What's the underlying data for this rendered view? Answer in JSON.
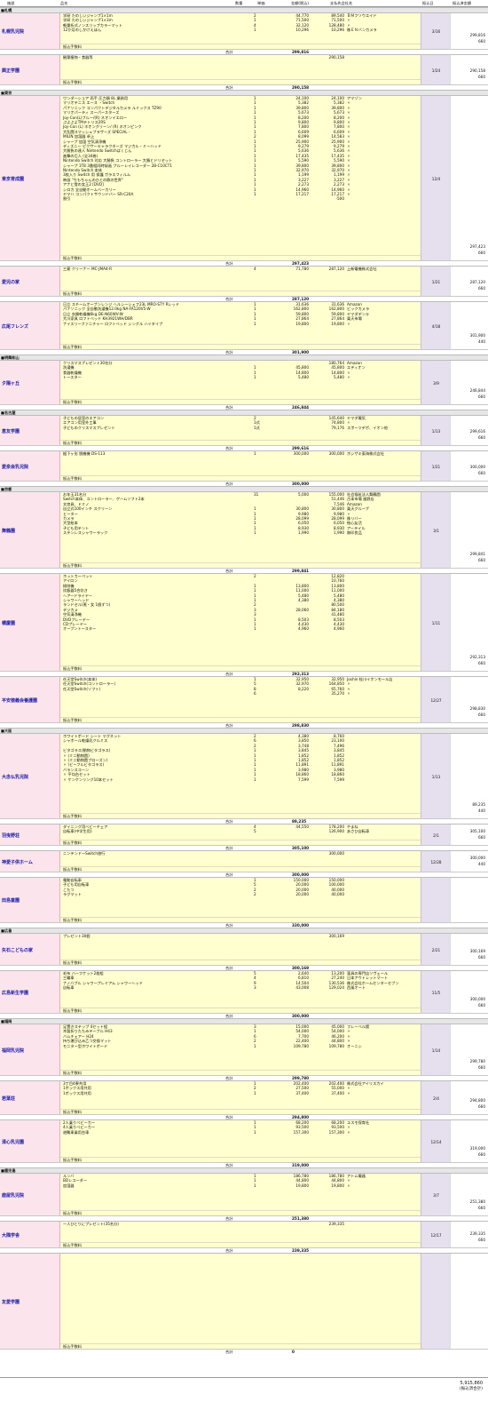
{
  "header": [
    "施設",
    "品名",
    "数量",
    "単価",
    "金額(税込)",
    "支払先会社名",
    "振込日",
    "振込済金額"
  ],
  "fee_label": "振込手数料",
  "total_label": "合計",
  "rows": [
    {
      "r": "■札幌"
    },
    {
      "f": "札幌乳児院",
      "d": "3/16",
      "t": [
        "299,816",
        "660"
      ],
      "s": "299,816",
      "h": 47,
      "i": [
        [
          "学研 たのしいジャンプ1×1m",
          "2",
          "44,770",
          "89,540",
          "ＢＭフソウエイド"
        ],
        [
          "学研 たのしいジャンプ1×3m",
          "1",
          "71,500",
          "71,500",
          "〃"
        ],
        [
          "軽量折式ノンスリップカラーマット",
          "4",
          "32,120",
          "128,480",
          "〃"
        ],
        [
          "12か月のしかけえほん",
          "1",
          "10,296",
          "10,296",
          "株ＥＮバンカメラ"
        ]
      ]
    },
    {
      "f": "興正学園",
      "d": "1/24",
      "t": [
        "290,158",
        "660"
      ],
      "s": "290,158",
      "h": 40,
      "i": [
        [
          "観葉植物・食器等",
          "",
          "",
          "290,158",
          ""
        ]
      ]
    },
    {
      "r": "■東京"
    },
    {
      "f": "東京育成園",
      "d": "12/4",
      "t": [
        "297,423",
        "660"
      ],
      "s": "297,423",
      "h": 192,
      "i": [
        [
          "ワンダーショア 両手 圧力鍋 8L 業務用",
          "1",
          "24,100",
          "24,100",
          "アマゾン"
        ],
        [
          "マリオテニス エース ・Switch",
          "1",
          "5,382",
          "5,382",
          "〃"
        ],
        [
          "パナソニック コンパクトデジタルカメラ ルミックス TZ90",
          "1",
          "39,800",
          "39,800",
          "〃"
        ],
        [
          "マリオパーティ スーパースターズ",
          "1",
          "5,673",
          "5,673",
          "〃"
        ],
        [
          "Joy-Con(L)ブルー/(R) ネオンイエロー",
          "1",
          "8,200",
          "8,200",
          "〃"
        ],
        [
          "ぷよぷよTMテトリス2RS",
          "1",
          "9,800",
          "9,800",
          "〃"
        ],
        [
          "Joy-Con (L) ネオングリーン/ (R) ネオンピンク",
          "1",
          "7,800",
          "7,800",
          "〃"
        ],
        [
          "大乱闘スマッシュブラザーズ SPECIAL -",
          "1",
          "6,609",
          "6,609",
          "〃"
        ],
        [
          "MILIN 加湿器 卓上",
          "2",
          "8,099",
          "14,583",
          "〃"
        ],
        [
          "シャープ 加湿 空気清浄機",
          "1",
          "25,900",
          "25,900",
          "〃"
        ],
        [
          "ディズニー ピクサーキャラクターズ マジカル・ミーハッド",
          "1",
          "9,279",
          "9,279",
          "〃"
        ],
        [
          "大勝負の達人 Nintendo Switchばくじん",
          "1",
          "5,636",
          "5,636",
          "〃"
        ],
        [
          "進撃の巨人 (全34巻)",
          "1",
          "17,435",
          "17,435",
          "〃"
        ],
        [
          "Nintendo Switch 対応 大勝負 コントローラー 大勝とドリセット",
          "1",
          "5,590",
          "5,590",
          "〃"
        ],
        [
          "シャープ 1TB 3番組同時録画 ブルーレイレコーダー 2B-C10CT1",
          "1",
          "39,800",
          "39,800",
          "〃"
        ],
        [
          "Nintendo Switch 本体",
          "1",
          "32,970",
          "32,970",
          "〃"
        ],
        [
          "3枚入り Switch 用 保護 ガラスフィルム",
          "1",
          "1,199",
          "1,199",
          "〃"
        ],
        [
          "映画 \"ちもちゃんのひとの歌の世界\"",
          "1",
          "3,227",
          "3,227",
          "〃"
        ],
        [
          "アナと雪の女王2 [DVD]",
          "1",
          "2,273",
          "2,273",
          "〃"
        ],
        [
          "シロカ 全自動ホームベーカリー",
          "1",
          "14,960",
          "14,960",
          "〃"
        ],
        [
          "ヤマハ コンパクトサウンドバー SR-C20A",
          "1",
          "17,217",
          "17,217",
          "〃"
        ],
        [
          "割引",
          "",
          "",
          "-500",
          ""
        ]
      ]
    },
    {
      "f": "愛児の家",
      "d": "1/21",
      "t": [
        "287,120",
        "660"
      ],
      "s": "287,120",
      "h": 40,
      "i": [
        [
          "三菱 クリーナー MC-JMA4-R",
          "4",
          "71,780",
          "287,120",
          "上新電機株式会社"
        ]
      ]
    },
    {
      "f": "広尾フレンズ",
      "d": "4/18",
      "t": [
        "301,900",
        "440"
      ],
      "s": "301,900",
      "h": 60,
      "i": [
        [
          "日立 スチームオーブンレンジ ヘルシーシェフ23L MRO-S7Y Rレッド",
          "1",
          "31,636",
          "31,636",
          "Amazon"
        ],
        [
          "パナソニック 全自動洗濯機12.0kg NA-FA120V5-W",
          "1",
          "162,800",
          "162,800",
          "ビックカメラ"
        ],
        [
          "日立 衣類乾燥機6kg DE-N60WV-W",
          "1",
          "59,800",
          "59,800",
          "ヤマダデンキ"
        ],
        [
          "大川家具 ロフトベッド KH3921WH/DBR",
          "1",
          "27,864",
          "27,864",
          "楽天市場"
        ],
        [
          "ナイスリーファニチャー ロフトベッド シングル ハイタイプ",
          "1",
          "19,800",
          "19,800",
          "〃"
        ]
      ]
    },
    {
      "r": "■明舞和山"
    },
    {
      "f": "夕陽ヶ丘",
      "d": "3/9",
      "t": [
        "246,844",
        "660"
      ],
      "s": "246,844",
      "h": 56,
      "i": [
        [
          "クリスマスプレゼント30名分",
          "",
          "",
          "180,764",
          "Amazon"
        ],
        [
          "洗濯機",
          "1",
          "45,800",
          "45,800",
          "エディオン"
        ],
        [
          "食器乾燥機",
          "1",
          "14,800",
          "14,800",
          "〃"
        ],
        [
          "トースター",
          "1",
          "5,480",
          "5,480",
          "〃"
        ]
      ]
    },
    {
      "r": "■名古屋"
    },
    {
      "f": "恵友学園",
      "d": "1/13",
      "t": [
        "299,616",
        "660"
      ],
      "s": "299,616",
      "h": 40,
      "i": [
        [
          "子どもの居室のエアコン",
          "2",
          "",
          "145,640",
          "ヤマダ電気"
        ],
        [
          "エアコン用室外工事",
          "1式",
          "",
          "74,800",
          "〃"
        ],
        [
          "子どものクリスマスプレゼント",
          "1式",
          "",
          "79,176",
          "スポーツデポ、イオン他"
        ]
      ]
    },
    {
      "f": "愛泉会乳児院",
      "d": "1/21",
      "t": [
        "300,000",
        "660"
      ],
      "s": "300,000",
      "h": 40,
      "i": [
        [
          "据下ヶ形 脱機機 DS-113",
          "1",
          "300,000",
          "300,000",
          "ホシザキ東海株式会社"
        ]
      ]
    },
    {
      "r": "■京都"
    },
    {
      "f": "舞鶴園",
      "d": "3/1",
      "t": [
        "299,841",
        "660"
      ],
      "s": "299,841",
      "h": 92,
      "i": [
        [
          "お年玉31名分",
          "31",
          "5,000",
          "155,000",
          "社会福祉法人舞鶴園"
        ],
        [
          "Switch本体、コントローラー、ゲームソフト2本",
          "",
          "",
          "51,446",
          "古本市場 嵐野店"
        ],
        [
          "文房具、ドミノ",
          "",
          "",
          "7,546",
          "Amazon"
        ],
        [
          "自立式100インチ スクリーン",
          "1",
          "30,800",
          "30,800",
          "楽天グループ"
        ],
        [
          "ヒーター",
          "1",
          "9,980",
          "9,980",
          "〃"
        ],
        [
          "カメラ",
          "1",
          "28,099",
          "28,099",
          "株リバー"
        ],
        [
          "大型絵本",
          "1",
          "6,050",
          "6,050",
          "絵心友活"
        ],
        [
          "子ども用テント",
          "1",
          "8,930",
          "8,930",
          "アーテイル"
        ],
        [
          "ステンレスシャワーラック",
          "1",
          "1,990",
          "1,990",
          "無印良品"
        ]
      ]
    },
    {
      "f": "積慶園",
      "d": "1/11",
      "t": [
        "292,313",
        "660"
      ],
      "s": "292,313",
      "h": 116,
      "i": [
        [
          "ホットカーペット",
          "2",
          "",
          "12,820",
          ""
        ],
        [
          "アイロン",
          "",
          "",
          "10,760",
          ""
        ],
        [
          "掃除機",
          "1",
          "13,800",
          "13,800",
          ""
        ],
        [
          "炊飯器5合炊き",
          "1",
          "11,000",
          "11,000",
          ""
        ],
        [
          "ヘアードライヤー",
          "1",
          "5,480",
          "5,480",
          ""
        ],
        [
          "シャワーヘッド",
          "1",
          "4,380",
          "4,380",
          ""
        ],
        [
          "ランドセル(黒・女 1個ずつ)",
          "2",
          "",
          "80,500",
          ""
        ],
        [
          "デジカメ",
          "3",
          "28,060",
          "84,180",
          ""
        ],
        [
          "空気清浄機",
          "3",
          "",
          "41,480",
          ""
        ],
        [
          "DVDプレーヤー",
          "1",
          "8,503",
          "8,503",
          ""
        ],
        [
          "CDプレーヤー",
          "1",
          "4,430",
          "4,430",
          ""
        ],
        [
          "オーブントースター",
          "1",
          "4,960",
          "4,960",
          ""
        ]
      ]
    },
    {
      "f": "平安徳義会養護園",
      "d": "12/27",
      "t": [
        "298,830",
        "660"
      ],
      "s": "298,830",
      "h": 58,
      "i": [
        [
          "任天堂Switch(本体)",
          "1",
          "32,950",
          "32,950",
          "Joshin 桂川イオンモール店"
        ],
        [
          "任天堂Switch(コントローラー)",
          "5",
          "32,970",
          "164,850",
          "〃"
        ],
        [
          "任天堂Switch(ソフト)",
          "8",
          "8,220",
          "65,760",
          "〃"
        ],
        [
          "",
          "6",
          "",
          "35,270",
          "〃"
        ]
      ]
    },
    {
      "r": "■大阪"
    },
    {
      "f": "大念仏乳児院",
      "d": "1/13",
      "t": [
        "89,235",
        "440"
      ],
      "s": "89,235",
      "h": 102,
      "i": [
        [
          "ホワイトボード シート マグネット",
          "2",
          "4,380",
          "8,760",
          ""
        ],
        [
          "シャボール乾燥乳クルミス",
          "6",
          "3,850",
          "23,100",
          ""
        ],
        [
          "",
          "2",
          "3,748",
          "7,496",
          ""
        ],
        [
          "ビタゴラス(動物ビタゴラス)",
          "1",
          "3,845",
          "3,845",
          ""
        ],
        [
          "  〃 (ミニ動物園)",
          "1",
          "1,852",
          "1,852",
          ""
        ],
        [
          "  〃 (ミニ動物園ブローズン)",
          "1",
          "1,852",
          "1,852",
          ""
        ],
        [
          "  〃 (ビーフルビタゴラス)",
          "1",
          "11,891",
          "11,891",
          ""
        ],
        [
          "バランスコーン",
          "1",
          "3,980",
          "3,980",
          ""
        ],
        [
          "  〃 平均台セット",
          "1",
          "18,860",
          "18,860",
          ""
        ],
        [
          "  〃 ケンケンリング10本セット",
          "1",
          "7,599",
          "7,599",
          ""
        ]
      ]
    },
    {
      "f": "羽曳野荘",
      "d": "2/1",
      "t": [
        "305,100",
        "660"
      ],
      "s": "305,100",
      "h": 30,
      "i": [
        [
          "ダイニング用ベビーチェア",
          "4",
          "44,550",
          "178,200",
          "やまね"
        ],
        [
          "自転車(中学生用)",
          "5",
          "",
          "126,900",
          "あさひ自転車"
        ]
      ]
    },
    {
      "f": "神愛子供ホーム",
      "d": "12/28",
      "t": [
        "300,000",
        "440"
      ],
      "s": "300,000",
      "h": 30,
      "i": [
        [
          "ニンテンドーSwitch旅行",
          "",
          "",
          "300,000",
          ""
        ]
      ]
    },
    {
      "f": "田島童園",
      "d": "",
      "t": [
        "",
        ""
      ],
      "s": "330,000",
      "h": 57,
      "i": [
        [
          "電動自転車",
          "1",
          "150,000",
          "150,000",
          ""
        ],
        [
          "子ども用自転車",
          "5",
          "20,000",
          "100,000",
          ""
        ],
        [
          "こたつ",
          "2",
          "20,000",
          "40,000",
          ""
        ],
        [
          "ラグマット",
          "2",
          "20,000",
          "40,000",
          ""
        ]
      ]
    },
    {
      "r": "■広島"
    },
    {
      "f": "矢石こどもの家",
      "d": "2/21",
      "t": [
        "300,169",
        "660"
      ],
      "s": "300,169",
      "h": 42,
      "i": [
        [
          "プレゼント30個",
          "",
          "",
          "300,169",
          ""
        ]
      ]
    },
    {
      "f": "広島新生学園",
      "d": "11/5",
      "t": [
        "300,000",
        "660"
      ],
      "s": "300,000",
      "h": 54,
      "i": [
        [
          "毛布 ハーフケット2枚組",
          "5",
          "2,640",
          "13,200",
          "東具の専門店ソヴェール"
        ],
        [
          "三輪車",
          "4",
          "6,810",
          "27,240",
          "日本アウトレットマート"
        ],
        [
          "ナノバブル シャワープレミアム シャワーヘッド",
          "9",
          "14,504",
          "130,536",
          "株式会社ホームセンターセブン"
        ],
        [
          "自転車",
          "3",
          "43,008",
          "129,024",
          "西風オート"
        ]
      ]
    },
    {
      "r": "■福岡"
    },
    {
      "f": "福岡乳児院",
      "d": "1/14",
      "t": [
        "299,780",
        "660"
      ],
      "s": "299,780",
      "h": 64,
      "i": [
        [
          "足置きステップ 4セット組",
          "3",
          "15,000",
          "45,000",
          "フレーベル館"
        ],
        [
          "木製折りたたみテーブル H43",
          "1",
          "54,000",
          "54,000",
          "〃"
        ],
        [
          "バムチェアー H24",
          "6",
          "7,700",
          "46,200",
          "〃"
        ],
        [
          "持ち運び込み乙つ交換マット",
          "2",
          "22,400",
          "44,800",
          "〃"
        ],
        [
          "モニター型ホワイトボード",
          "1",
          "109,780",
          "109,780",
          "オーニシ"
        ]
      ]
    },
    {
      "f": "若葉荘",
      "d": "2/4",
      "t": [
        "294,800",
        "660"
      ],
      "s": "294,800",
      "h": 44,
      "i": [
        [
          "3丁目4寮共用",
          "1",
          "202,400",
          "202,400",
          "株式会社アイリスカイ"
        ],
        [
          "1ボックス用共用",
          "2",
          "27,500",
          "55,000",
          "〃"
        ],
        [
          "1ボックス用共用",
          "1",
          "37,400",
          "37,400",
          "〃"
        ]
      ]
    },
    {
      "f": "清心乳児園",
      "d": "12/14",
      "t": [
        "319,000",
        "660"
      ],
      "s": "319,000",
      "h": 54,
      "i": [
        [
          "2人乗りベビーカー",
          "1",
          "68,200",
          "68,200",
          "ユスモ保育社"
        ],
        [
          "4人乗りベビーカー",
          "1",
          "93,500",
          "93,500",
          "〃"
        ],
        [
          "避難車乗用台車",
          "1",
          "157,300",
          "157,300",
          "〃"
        ]
      ]
    },
    {
      "r": "■鹿児島"
    },
    {
      "f": "鹿屋乳児院",
      "d": "3/7",
      "t": [
        "251,380",
        "660"
      ],
      "s": "251,380",
      "h": 54,
      "i": [
        [
          "ルンバ",
          "1",
          "186,780",
          "186,780",
          "アトム電器"
        ],
        [
          "BDレコーダー",
          "1",
          "44,800",
          "44,800",
          "〃"
        ],
        [
          "加湿器",
          "1",
          "19,800",
          "19,800",
          "〃"
        ]
      ]
    },
    {
      "f": "大隅学舎",
      "d": "12/17",
      "t": [
        "239,335",
        "660"
      ],
      "s": "239,335",
      "h": 36,
      "i": [
        [
          "一人ひとりにプレゼント(35名分)",
          "",
          "",
          "239,335",
          ""
        ]
      ]
    },
    {
      "f": "友愛学園",
      "d": "",
      "t": [
        "",
        ""
      ],
      "s": "0",
      "h": 114,
      "i": []
    }
  ],
  "grand_total": "5,915,860",
  "grand_total_note": "(振込済合計)"
}
